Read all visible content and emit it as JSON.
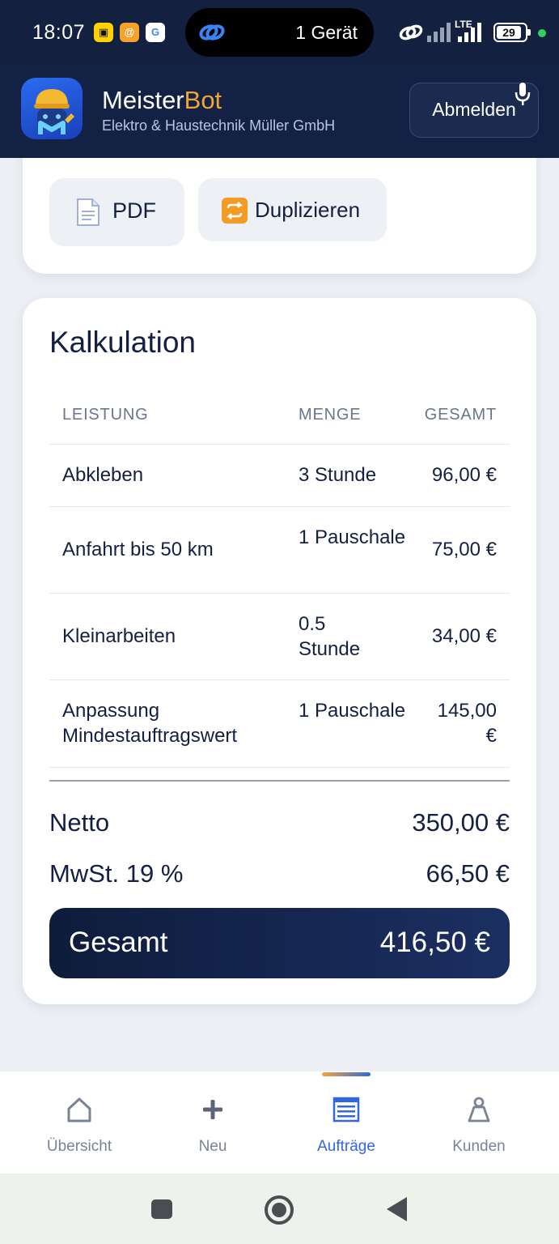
{
  "status_bar": {
    "time": "18:07",
    "pill_text": "1 Gerät",
    "network": "LTE",
    "battery": "29"
  },
  "header": {
    "brand_main": "Meister",
    "brand_accent": "Bot",
    "subtitle": "Elektro & Haustechnik Müller GmbH",
    "logout_label": "Abmelden"
  },
  "actions": {
    "pdf_label": "PDF",
    "duplicate_label": "Duplizieren"
  },
  "calculation": {
    "title": "Kalkulation",
    "headers": {
      "service": "LEISTUNG",
      "quantity": "MENGE",
      "total": "GESAMT"
    },
    "rows": [
      {
        "service": "Abkleben",
        "quantity": "3 Stunde",
        "total": "96,00 €"
      },
      {
        "service": "Anfahrt bis 50 km",
        "quantity": "1 Pauschale",
        "total": "75,00 €"
      },
      {
        "service": "Kleinarbeiten",
        "quantity": "0.5 Stunde",
        "total": "34,00 €"
      },
      {
        "service": "Anpassung Mindestauftragswert",
        "quantity": "1 Pauschale",
        "total": "145,00 €"
      }
    ],
    "net_label": "Netto",
    "net_value": "350,00 €",
    "vat_label": "MwSt. 19 %",
    "vat_value": "66,50 €",
    "total_label": "Gesamt",
    "total_value": "416,50 €"
  },
  "bottom_nav": {
    "items": [
      {
        "label": "Übersicht",
        "icon": "home-icon"
      },
      {
        "label": "Neu",
        "icon": "plus-icon"
      },
      {
        "label": "Aufträge",
        "icon": "list-icon",
        "active": true
      },
      {
        "label": "Kunden",
        "icon": "person-icon"
      }
    ]
  },
  "colors": {
    "header_bg": "#132244",
    "accent": "#f3a53a",
    "active_nav": "#3167e0",
    "total_bg": "#0e1c3b"
  }
}
